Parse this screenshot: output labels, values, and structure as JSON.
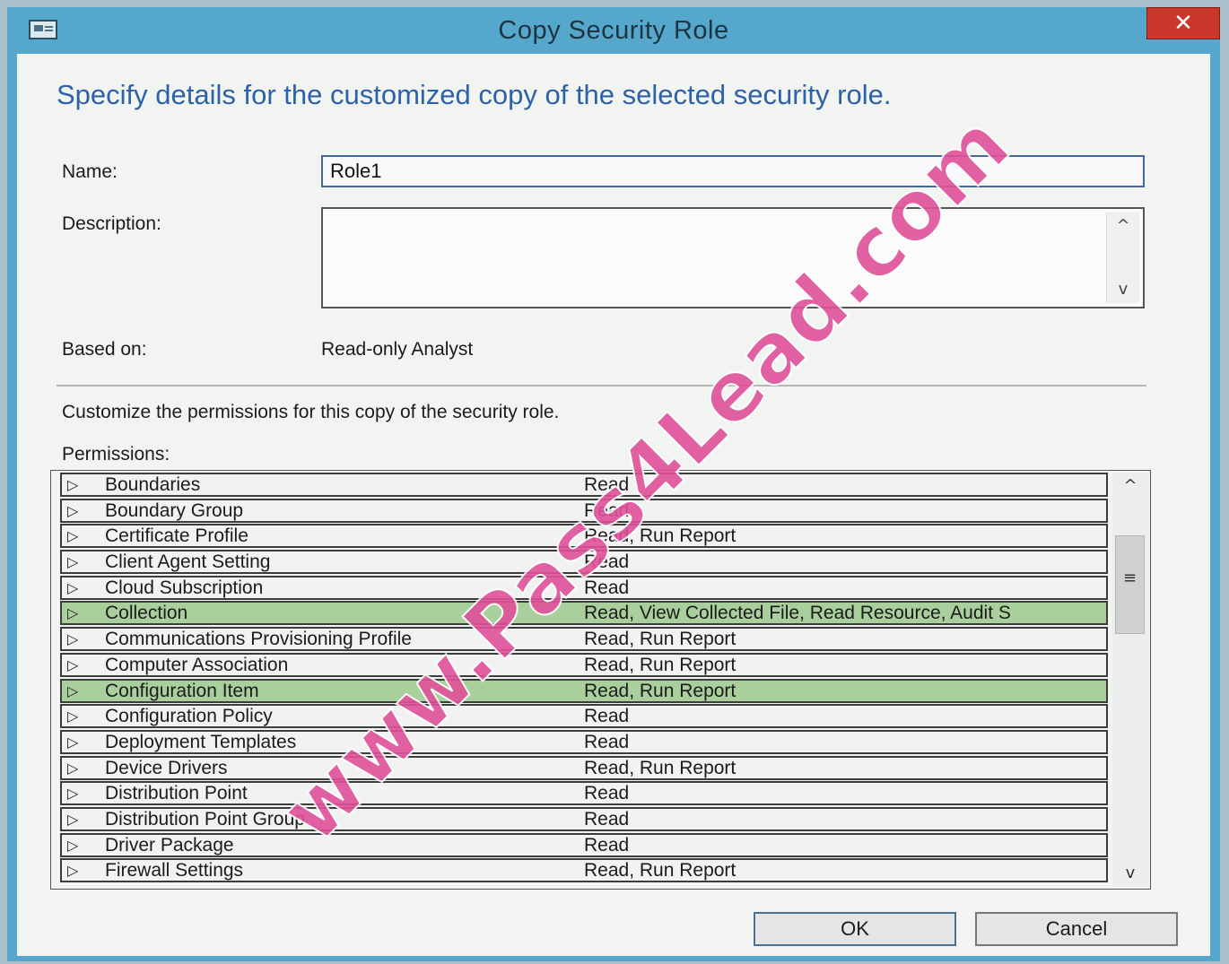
{
  "window": {
    "title": "Copy Security Role",
    "close_glyph": "✕",
    "system_icon": "window-menu-icon"
  },
  "heading": "Specify details for the customized copy of the selected security role.",
  "form": {
    "name_label": "Name:",
    "name_value": "Role1",
    "description_label": "Description:",
    "description_value": "",
    "based_on_label": "Based on:",
    "based_on_value": "Read-only Analyst"
  },
  "permissions": {
    "instructions": "Customize the permissions for this copy of the security role.",
    "label": "Permissions:",
    "expander_glyph": "▷",
    "rows": [
      {
        "name": "Boundaries",
        "value": "Read",
        "highlighted": false
      },
      {
        "name": "Boundary Group",
        "value": "Read",
        "highlighted": false
      },
      {
        "name": "Certificate Profile",
        "value": "Read, Run Report",
        "highlighted": false
      },
      {
        "name": "Client Agent Setting",
        "value": "Read",
        "highlighted": false
      },
      {
        "name": "Cloud Subscription",
        "value": "Read",
        "highlighted": false
      },
      {
        "name": "Collection",
        "value": "Read, View Collected File, Read Resource, Audit S",
        "highlighted": true
      },
      {
        "name": "Communications Provisioning Profile",
        "value": "Read, Run Report",
        "highlighted": false
      },
      {
        "name": "Computer Association",
        "value": "Read, Run Report",
        "highlighted": false
      },
      {
        "name": "Configuration Item",
        "value": "Read, Run Report",
        "highlighted": true
      },
      {
        "name": "Configuration Policy",
        "value": "Read",
        "highlighted": false
      },
      {
        "name": "Deployment Templates",
        "value": "Read",
        "highlighted": false
      },
      {
        "name": "Device Drivers",
        "value": "Read, Run Report",
        "highlighted": false
      },
      {
        "name": "Distribution Point",
        "value": "Read",
        "highlighted": false
      },
      {
        "name": "Distribution Point Group",
        "value": "Read",
        "highlighted": false
      },
      {
        "name": "Driver Package",
        "value": "Read",
        "highlighted": false
      },
      {
        "name": "Firewall Settings",
        "value": "Read, Run Report",
        "highlighted": false
      }
    ]
  },
  "buttons": {
    "ok": "OK",
    "cancel": "Cancel"
  },
  "scroll": {
    "up_glyph": "^",
    "down_glyph": "v",
    "grip_glyph": "≡"
  },
  "watermark": "www.Pass4Lead.com",
  "colors": {
    "title_bar": "#56a7cc",
    "close_button": "#c9382b",
    "heading_text": "#2d62a8",
    "row_highlight": "#a9cf9c",
    "watermark": "#e0519a"
  }
}
